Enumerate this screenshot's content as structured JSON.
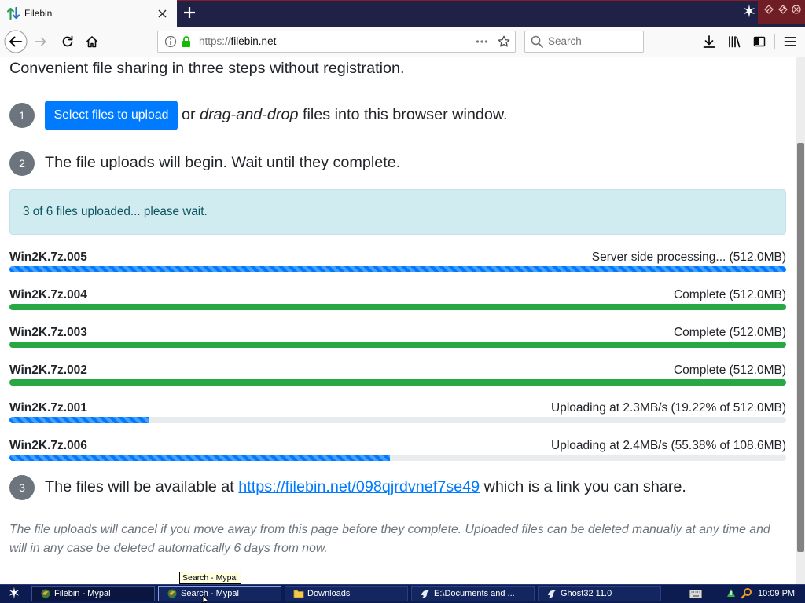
{
  "browser": {
    "tabs": [
      {
        "title": "Filebin"
      }
    ],
    "url_scheme": "https://",
    "url_host": "filebin.net",
    "search_placeholder": "Search",
    "toolbar_icons": [
      "back-icon",
      "forward-icon",
      "reload-icon",
      "home-icon",
      "info-icon",
      "lock-icon",
      "page-actions-icon",
      "bookmark-star-icon",
      "search-icon",
      "download-icon",
      "library-icon",
      "sidebar-icon",
      "menu-icon"
    ]
  },
  "page": {
    "intro": "Convenient file sharing in three steps without registration.",
    "step1": {
      "number": "1",
      "button": "Select files to upload",
      "text_or": "or",
      "text_italic": "drag-and-drop",
      "text_rest": "files into this browser window."
    },
    "step2": {
      "number": "2",
      "text": "The file uploads will begin. Wait until they complete."
    },
    "alert": "3 of 6 files uploaded... please wait.",
    "files": [
      {
        "name": "Win2K.7z.005",
        "status": "Server side processing... (512.0MB)",
        "progress": 1.0,
        "bar_color": "#007bff"
      },
      {
        "name": "Win2K.7z.004",
        "status": "Complete (512.0MB)",
        "progress": 1.0,
        "bar_color": "#28a745"
      },
      {
        "name": "Win2K.7z.003",
        "status": "Complete (512.0MB)",
        "progress": 1.0,
        "bar_color": "#28a745"
      },
      {
        "name": "Win2K.7z.002",
        "status": "Complete (512.0MB)",
        "progress": 1.0,
        "bar_color": "#28a745"
      },
      {
        "name": "Win2K.7z.001",
        "status": "Uploading at 2.3MB/s (19.22% of 512.0MB)",
        "progress": 0.18,
        "bar_color": "#007bff"
      },
      {
        "name": "Win2K.7z.006",
        "status": "Uploading at 2.4MB/s (55.38% of 108.6MB)",
        "progress": 0.49,
        "bar_color": "#007bff"
      }
    ],
    "step3": {
      "number": "3",
      "text_before": "The files will be available at",
      "link": "https://filebin.net/098qjrdvnef7se49",
      "text_after": "which is a link you can share."
    },
    "notice": "The file uploads will cancel if you move away from this page before they complete. Uploaded files can be deleted manually at any time and will in any case be deleted automatically 6 days from now."
  },
  "tooltip": "Search - Mypal",
  "taskbar": {
    "buttons": [
      {
        "label": "Filebin - Mypal",
        "icon": "mypal-icon"
      },
      {
        "label": "Search - Mypal",
        "icon": "mypal-icon"
      },
      {
        "label": "Downloads",
        "icon": "folder-icon"
      },
      {
        "label": "E:\\Documents and ...",
        "icon": "app-icon"
      },
      {
        "label": "Ghost32 11.0",
        "icon": "app-icon"
      }
    ],
    "clock": "10:09 PM"
  },
  "colors": {
    "primary": "#007bff",
    "success": "#28a745",
    "alert_bg": "#d1ecf1",
    "step_badge": "#6c757d",
    "secure_lock": "#12bc00"
  }
}
